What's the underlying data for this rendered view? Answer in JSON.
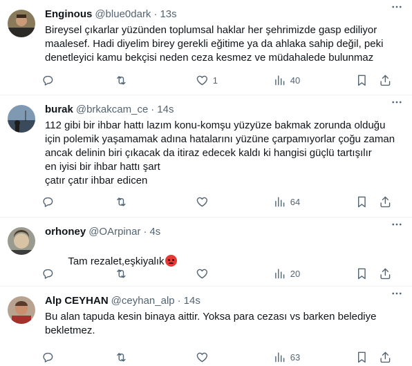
{
  "tweets": [
    {
      "name": "Enginous",
      "handle": "@blue0dark",
      "dot": "·",
      "time": "13s",
      "text": "Bireysel çıkarlar yüzünden toplumsal haklar her şehrimizde gasp ediliyor\nmaalesef. Hadi diyelim birey gerekli eğitime ya da ahlaka sahip değil, peki\ndenetleyici kamu bekçisi neden ceza kesmez ve müdahalede bulunmaz",
      "likes": "1",
      "views": "40",
      "replies": "",
      "retweets": ""
    },
    {
      "name": "burak",
      "handle": "@brkakcam_ce",
      "dot": "·",
      "time": "14s",
      "text": "112 gibi bir ihbar hattı lazım konu-komşu yüzyüze bakmak zorunda olduğu\niçin polemik yaşamamak adına hatalarını yüzüne çarpamıyorlar çoğu zaman\nancak delinin biri çıkacak da itiraz edecek kaldı ki hangisi güçlü tartışılır\nen iyisi bir ihbar hattı şart\nçatır çatır ihbar edicen",
      "likes": "",
      "views": "64",
      "replies": "",
      "retweets": ""
    },
    {
      "name": "orhoney",
      "handle": "@OArpinar",
      "dot": "·",
      "time": "4s",
      "text": "Tam rezalet,eşkiyalık",
      "likes": "",
      "views": "20",
      "replies": "",
      "retweets": ""
    },
    {
      "name": "Alp CEYHAN",
      "handle": "@ceyhan_alp",
      "dot": "·",
      "time": "14s",
      "text": "Bu alan tapuda kesin binaya aittir. Yoksa para cezası vs barken belediye\nbekletmez.",
      "likes": "",
      "views": "63",
      "replies": "",
      "retweets": ""
    }
  ],
  "colors": {
    "text": "#0f1419",
    "secondary": "#536471",
    "divider": "#eff3f4",
    "emoji": "#e53935"
  },
  "icons": [
    "more-icon",
    "reply-icon",
    "retweet-icon",
    "like-icon",
    "views-icon",
    "bookmark-icon",
    "share-icon",
    "angry-face-emoji"
  ]
}
